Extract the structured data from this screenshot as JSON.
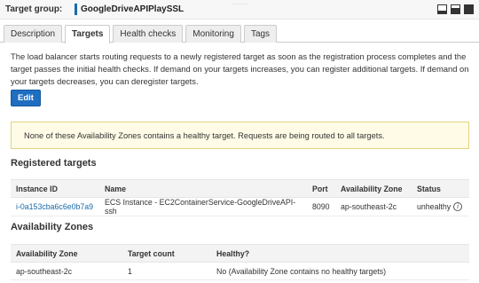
{
  "header": {
    "label": "Target group:",
    "name": "GoogleDriveAPIPlaySSL"
  },
  "tabs": [
    {
      "label": "Description"
    },
    {
      "label": "Targets"
    },
    {
      "label": "Health checks"
    },
    {
      "label": "Monitoring"
    },
    {
      "label": "Tags"
    }
  ],
  "description": "The load balancer starts routing requests to a newly registered target as soon as the registration process completes and the target passes the initial health checks. If demand on your targets increases, you can register additional targets. If demand on your targets decreases, you can deregister targets.",
  "edit_label": "Edit",
  "alert": "None of these Availability Zones contains a healthy target. Requests are being routed to all targets.",
  "registered": {
    "title": "Registered targets",
    "columns": [
      "Instance ID",
      "Name",
      "Port",
      "Availability Zone",
      "Status"
    ],
    "rows": [
      {
        "instance_id": "i-0a153cba6c6e0b7a9",
        "name": "ECS Instance - EC2ContainerService-GoogleDriveAPI-ssh",
        "port": "8090",
        "az": "ap-southeast-2c",
        "status": "unhealthy"
      }
    ]
  },
  "zones": {
    "title": "Availability Zones",
    "columns": [
      "Availability Zone",
      "Target count",
      "Healthy?"
    ],
    "rows": [
      {
        "az": "ap-southeast-2c",
        "count": "1",
        "healthy": "No (Availability Zone contains no healthy targets)"
      }
    ]
  },
  "colors": {
    "accent": "#1f6ec1",
    "link": "#1a6aa8",
    "alert_bg": "#fffbe6"
  },
  "icons": [
    "drag-handle-icon",
    "panel-minimize-icon",
    "panel-split-icon",
    "panel-maximize-icon",
    "info-icon"
  ]
}
